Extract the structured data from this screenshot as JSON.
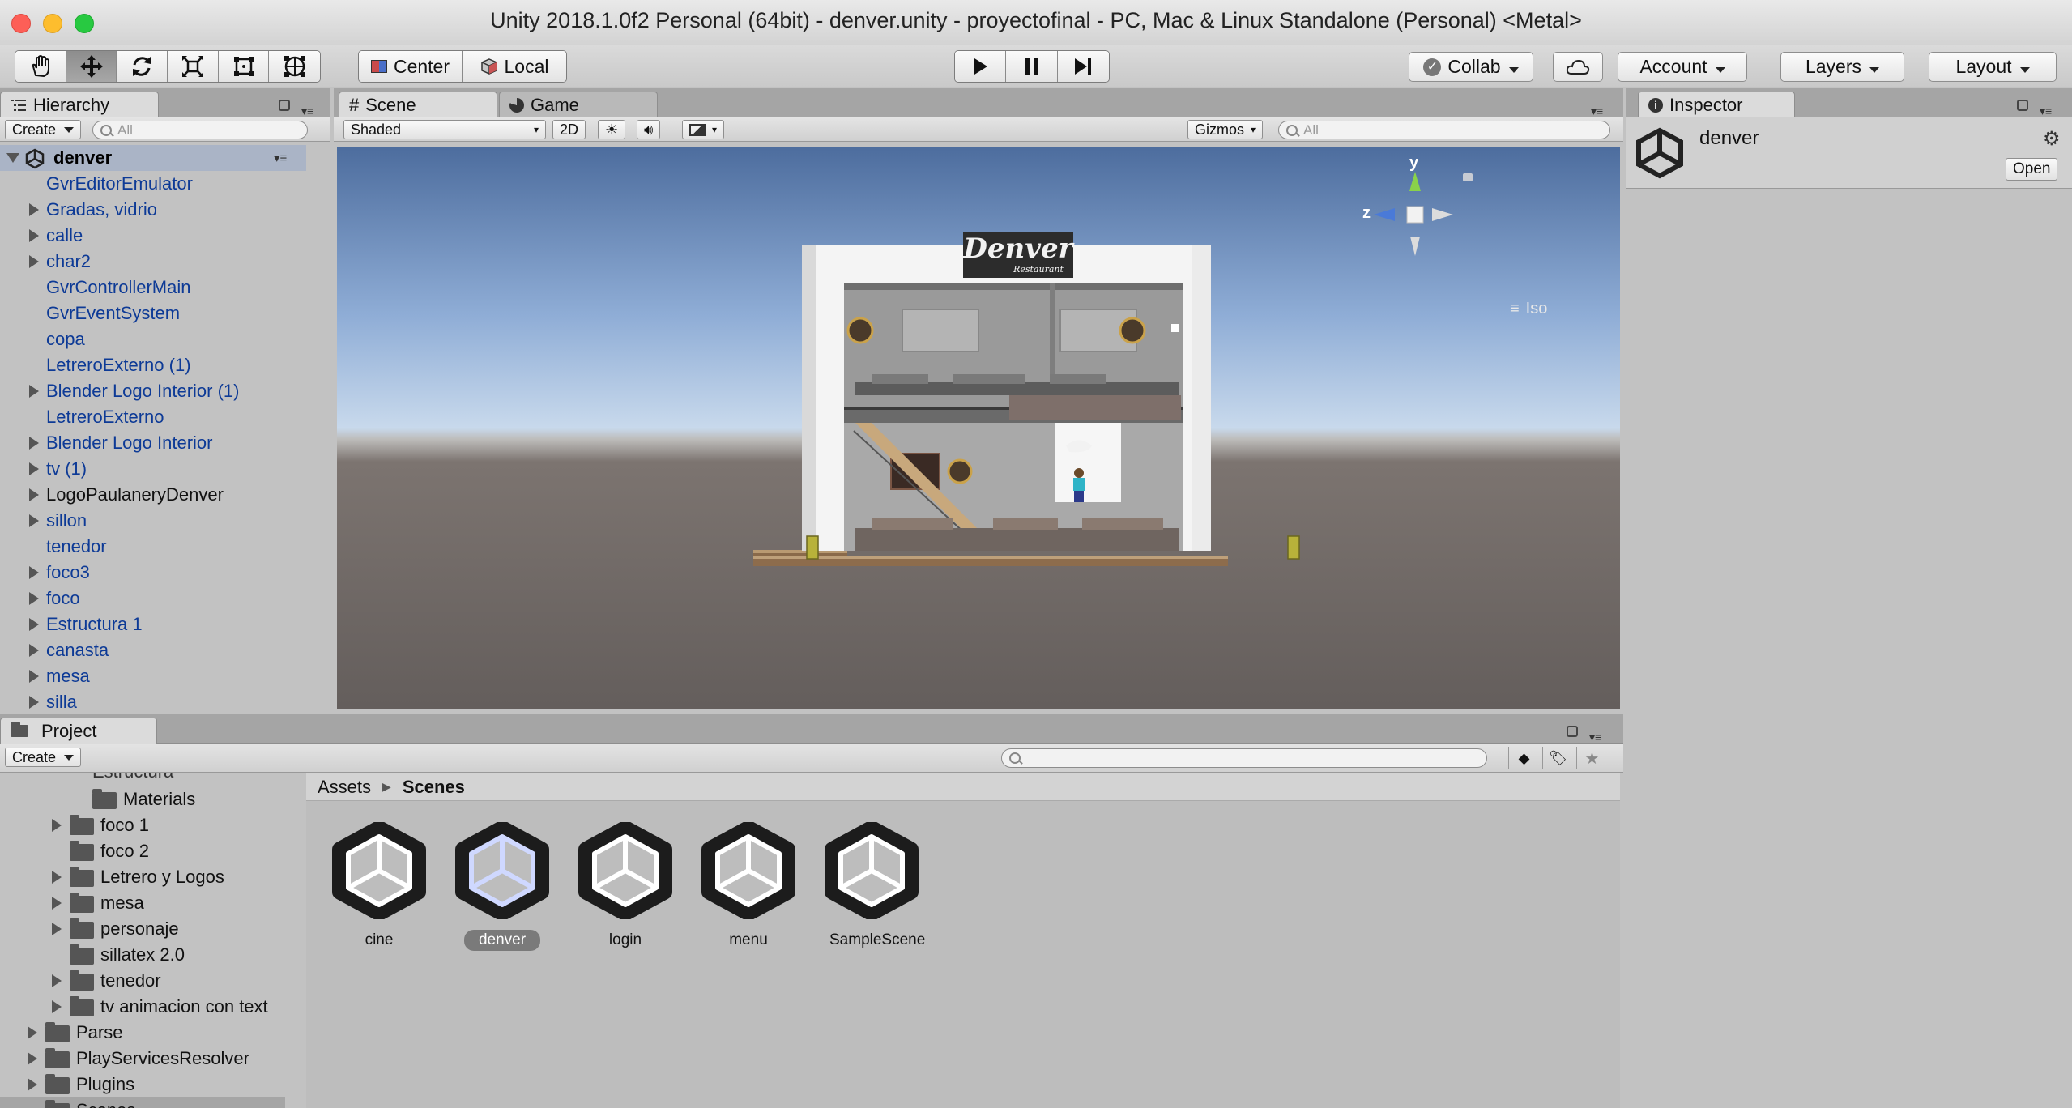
{
  "window": {
    "title": "Unity 2018.1.0f2 Personal (64bit) - denver.unity - proyectofinal - PC, Mac & Linux Standalone (Personal) <Metal>",
    "traffic_colors": [
      "#fd5f57",
      "#fdbd2e",
      "#28c941"
    ]
  },
  "toolbar": {
    "transform_tools": [
      "hand-tool-icon",
      "move-tool-icon",
      "rotate-tool-icon",
      "scale-tool-icon",
      "rect-tool-icon",
      "transform-tool-icon"
    ],
    "pivot_label": "Center",
    "space_label": "Local",
    "play_controls": [
      "play-icon",
      "pause-icon",
      "step-icon"
    ],
    "collab_label": "Collab",
    "account_label": "Account",
    "layers_label": "Layers",
    "layout_label": "Layout"
  },
  "hierarchy": {
    "tab_label": "Hierarchy",
    "create_label": "Create",
    "search_placeholder": "All",
    "scene_name": "denver",
    "items": [
      {
        "label": "GvrEditorEmulator",
        "expandable": false
      },
      {
        "label": "Gradas, vidrio",
        "expandable": true
      },
      {
        "label": "calle",
        "expandable": true
      },
      {
        "label": "char2",
        "expandable": true
      },
      {
        "label": "GvrControllerMain",
        "expandable": false
      },
      {
        "label": "GvrEventSystem",
        "expandable": false
      },
      {
        "label": "copa",
        "expandable": false
      },
      {
        "label": "LetreroExterno (1)",
        "expandable": false
      },
      {
        "label": "Blender Logo Interior (1)",
        "expandable": true
      },
      {
        "label": "LetreroExterno",
        "expandable": false
      },
      {
        "label": "Blender Logo Interior",
        "expandable": true
      },
      {
        "label": "tv (1)",
        "expandable": true
      },
      {
        "label": "LogoPaulaneryDenver",
        "expandable": true,
        "black": true
      },
      {
        "label": "sillon",
        "expandable": true
      },
      {
        "label": "tenedor",
        "expandable": false
      },
      {
        "label": "foco3",
        "expandable": true
      },
      {
        "label": "foco",
        "expandable": true
      },
      {
        "label": "Estructura 1",
        "expandable": true
      },
      {
        "label": "canasta",
        "expandable": true
      },
      {
        "label": "mesa",
        "expandable": true
      },
      {
        "label": "silla",
        "expandable": true
      }
    ]
  },
  "scene": {
    "tab_label": "Scene",
    "game_tab_label": "Game",
    "shading_mode": "Shaded",
    "mode_2d": "2D",
    "gizmos_label": "Gizmos",
    "search_placeholder": "All",
    "gizmo_y": "y",
    "gizmo_z": "z",
    "projection_label": "Iso",
    "sign_text": "Denver",
    "sign_subtext": "Restaurant"
  },
  "inspector": {
    "tab_label": "Inspector",
    "object_name": "denver",
    "open_label": "Open"
  },
  "project": {
    "tab_label": "Project",
    "create_label": "Create",
    "tree_top_partial": "Estructura",
    "tree": [
      {
        "label": "Materials",
        "level": 2,
        "expandable": false
      },
      {
        "label": "foco 1",
        "level": 1,
        "expandable": true
      },
      {
        "label": "foco 2",
        "level": 1,
        "expandable": false
      },
      {
        "label": "Letrero y Logos",
        "level": 1,
        "expandable": true
      },
      {
        "label": "mesa",
        "level": 1,
        "expandable": true
      },
      {
        "label": "personaje",
        "level": 1,
        "expandable": true
      },
      {
        "label": "sillatex 2.0",
        "level": 1,
        "expandable": false
      },
      {
        "label": "tenedor",
        "level": 1,
        "expandable": true
      },
      {
        "label": "tv animacion con text",
        "level": 1,
        "expandable": true
      },
      {
        "label": "Parse",
        "level": 0,
        "expandable": true
      },
      {
        "label": "PlayServicesResolver",
        "level": 0,
        "expandable": true
      },
      {
        "label": "Plugins",
        "level": 0,
        "expandable": true
      },
      {
        "label": "Scenes",
        "level": 0,
        "expandable": false,
        "selected": true
      }
    ],
    "breadcrumb": [
      "Assets",
      "Scenes"
    ],
    "assets": [
      {
        "label": "cine",
        "selected": false
      },
      {
        "label": "denver",
        "selected": true
      },
      {
        "label": "login",
        "selected": false
      },
      {
        "label": "menu",
        "selected": false
      },
      {
        "label": "SampleScene",
        "selected": false
      }
    ]
  }
}
